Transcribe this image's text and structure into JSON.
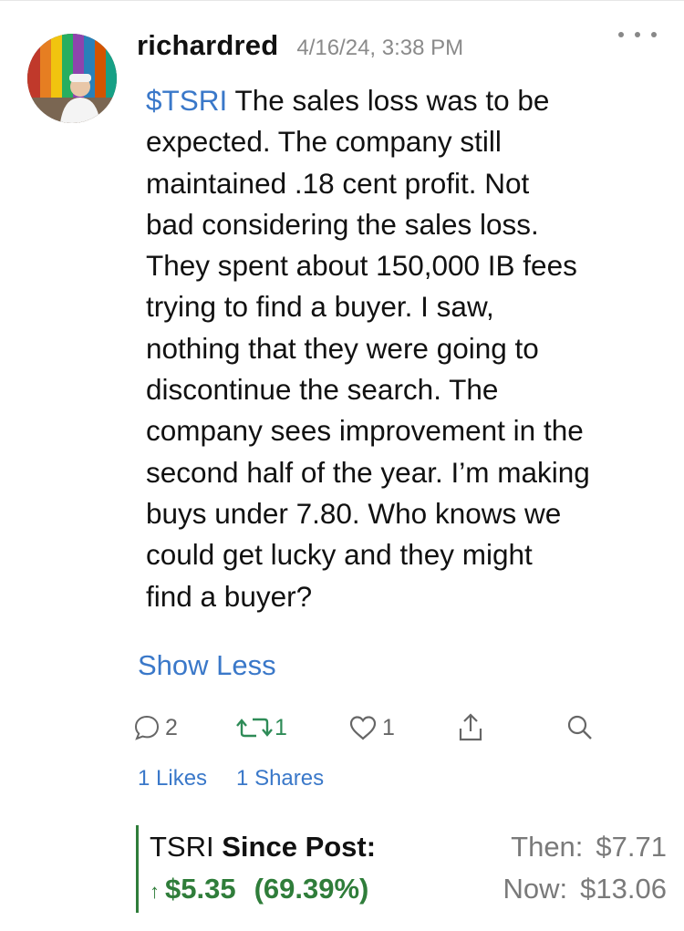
{
  "post": {
    "username": "richardred",
    "timestamp": "4/16/24, 3:38 PM",
    "ticker": "$TSRI",
    "body_lines": [
      "The sales loss was to be",
      "expected.  The company still",
      "maintained .18 cent profit.  Not",
      "bad considering the sales loss.",
      "They spent about 150,000 IB fees",
      "trying to find a buyer.  I saw,",
      "nothing that they were going to",
      "discontinue the search. The",
      "company sees improvement in the",
      "second half of the year. I’m making",
      "buys under 7.80.  Who knows we",
      "could get lucky and they might",
      "find a buyer?"
    ],
    "show_less_label": "Show Less"
  },
  "actions": {
    "comments": "2",
    "reshares": "1",
    "likes": "1"
  },
  "stats": {
    "likes_label": "1 Likes",
    "shares_label": "1 Shares"
  },
  "performance": {
    "symbol": "TSRI",
    "since_post_label": "Since Post:",
    "arrow": "↑",
    "change": "$5.35",
    "change_pct": "(69.39%)",
    "then_label": "Then:",
    "then_price": "$7.71",
    "now_label": "Now:",
    "now_price": "$13.06"
  },
  "colors": {
    "accent_blue": "#3a78c9",
    "reshare_green": "#2e8b57",
    "gain_green": "#2f7d3a",
    "muted_gray": "#8a8a8a"
  },
  "icons": [
    "comment-icon",
    "reshare-icon",
    "heart-icon",
    "share-icon",
    "search-icon",
    "more-icon"
  ]
}
